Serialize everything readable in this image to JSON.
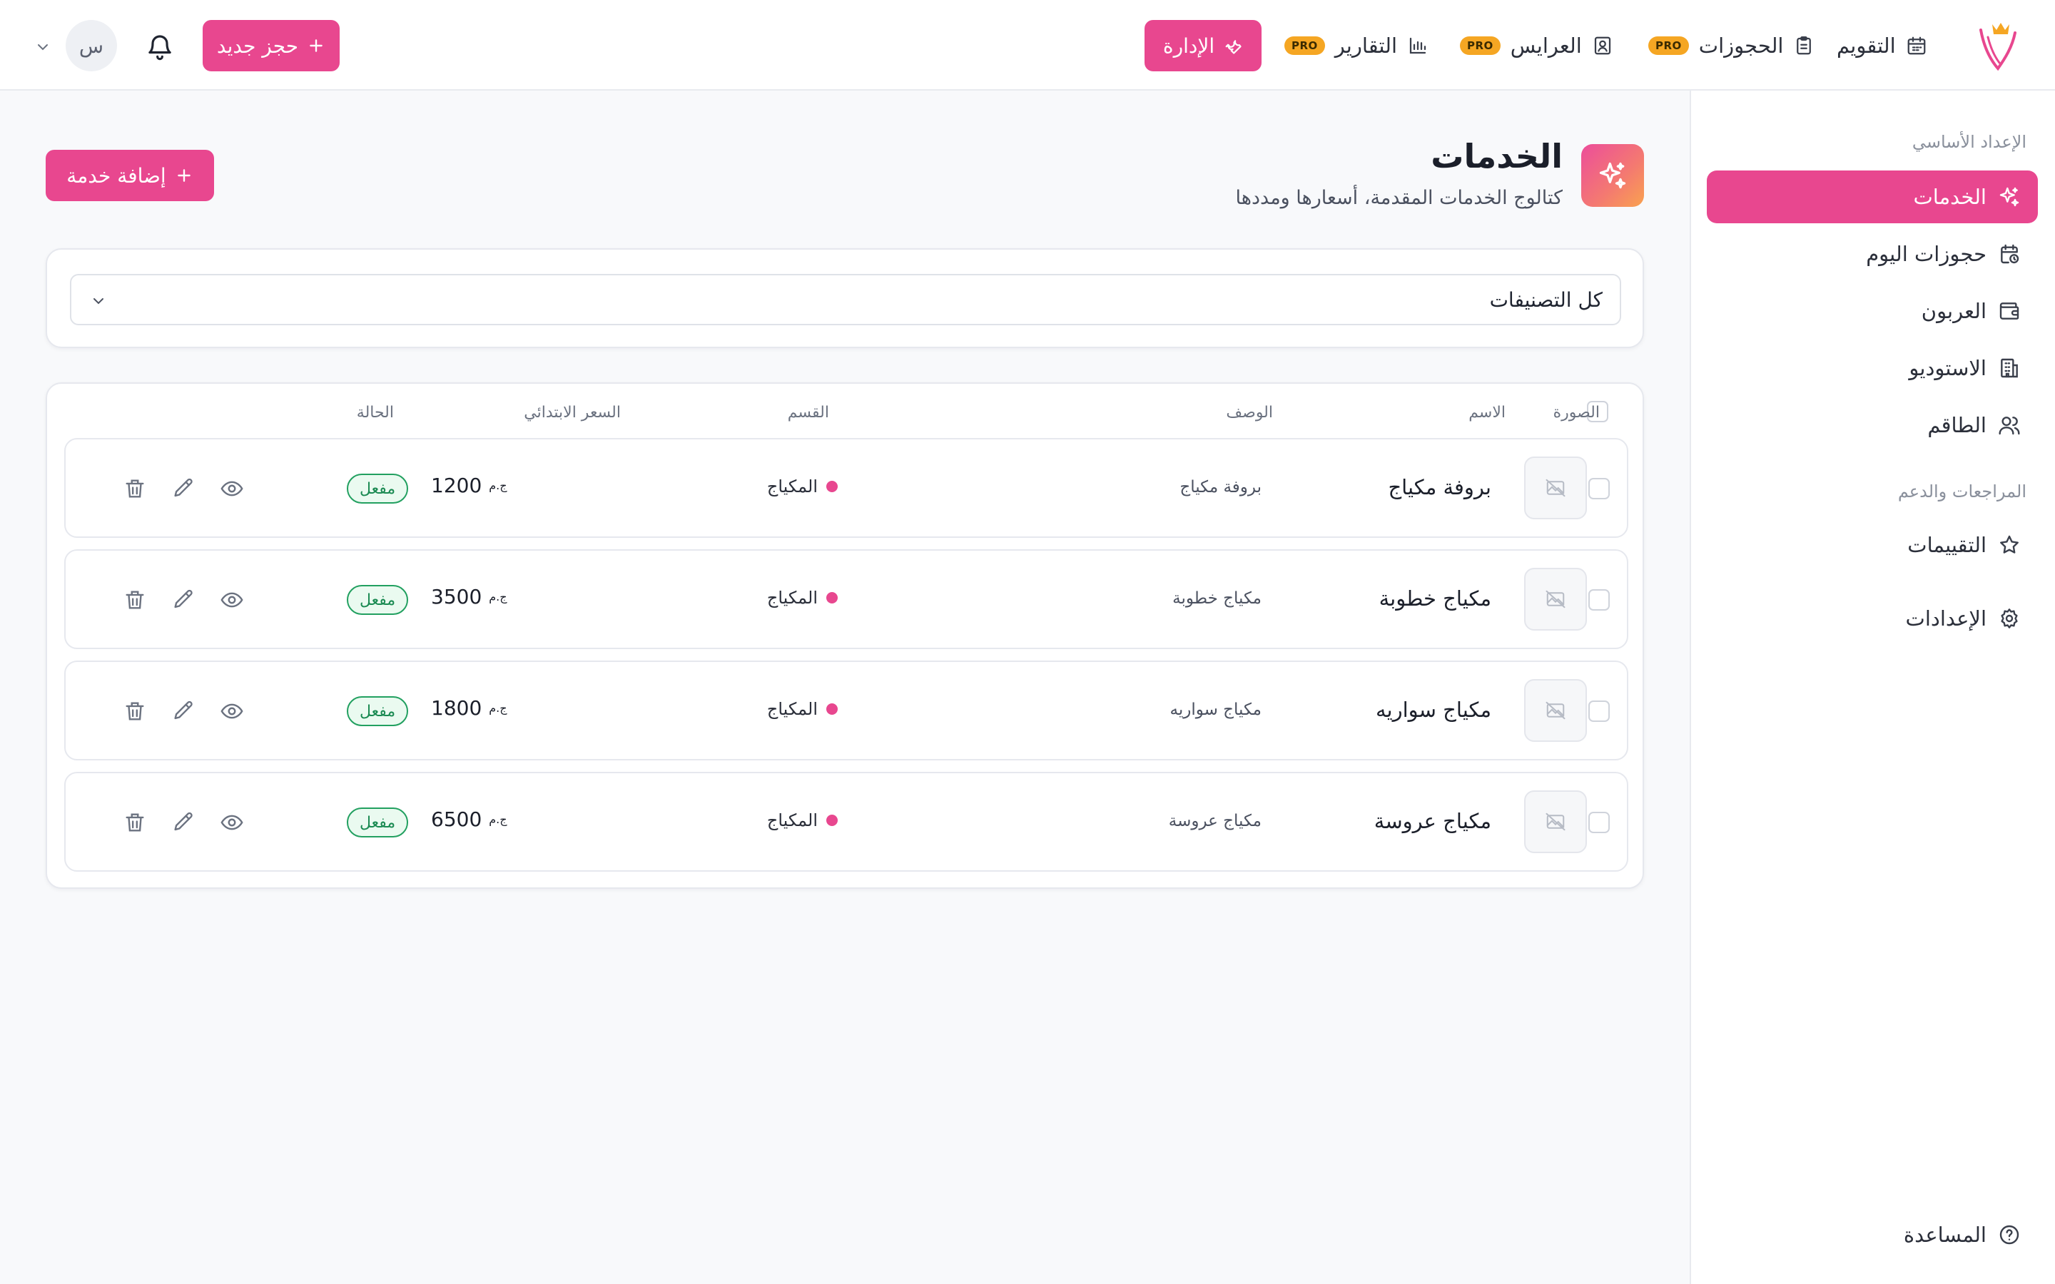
{
  "topbar": {
    "nav": [
      {
        "label": "التقويم",
        "icon": "calendar-icon"
      },
      {
        "label": "الحجوزات",
        "icon": "clipboard-icon",
        "badge": "PRO"
      },
      {
        "label": "العرايس",
        "icon": "contact-badge-icon",
        "badge": "PRO"
      },
      {
        "label": "التقارير",
        "icon": "bar-chart-icon",
        "badge": "PRO"
      }
    ],
    "admin_label": "الإدارة",
    "new_booking_label": "حجز جديد",
    "avatar_initial": "س"
  },
  "sidebar": {
    "section_basic": "الإعداد الأساسي",
    "items_basic": [
      {
        "label": "الخدمات",
        "icon": "sparkles-icon",
        "active": true
      },
      {
        "label": "حجوزات اليوم",
        "icon": "calendar-clock-icon"
      },
      {
        "label": "العربون",
        "icon": "wallet-icon"
      },
      {
        "label": "الاستوديو",
        "icon": "building-icon"
      },
      {
        "label": "الطاقم",
        "icon": "users-icon"
      }
    ],
    "section_reviews": "المراجعات والدعم",
    "items_reviews": [
      {
        "label": "التقييمات",
        "icon": "star-icon"
      }
    ],
    "settings_label": "الإعدادات",
    "help_label": "المساعدة"
  },
  "page": {
    "title": "الخدمات",
    "subtitle": "كتالوج الخدمات المقدمة، أسعارها ومددها",
    "add_service_label": "إضافة خدمة"
  },
  "filter": {
    "category_value": "كل التصنيفات"
  },
  "table": {
    "headers": {
      "image": "الصورة",
      "name": "الاسم",
      "description": "الوصف",
      "category": "القسم",
      "start_price": "السعر الابتدائي",
      "status": "الحالة"
    },
    "currency_symbol": "ج.م",
    "rows": [
      {
        "name": "بروفة مكياج",
        "description": "بروفة مكياج",
        "category": "المكياج",
        "price": "1200",
        "status": "مفعل"
      },
      {
        "name": "مكياج خطوبة",
        "description": "مكياج خطوبة",
        "category": "المكياج",
        "price": "3500",
        "status": "مفعل"
      },
      {
        "name": "مكياج سواريه",
        "description": "مكياج سواريه",
        "category": "المكياج",
        "price": "1800",
        "status": "مفعل"
      },
      {
        "name": "مكياج عروسة",
        "description": "مكياج عروسة",
        "category": "المكياج",
        "price": "6500",
        "status": "مفعل"
      }
    ]
  },
  "colors": {
    "accent": "#e8478f",
    "pro_badge": "#f5a623",
    "status_active": "#1a8a52"
  }
}
